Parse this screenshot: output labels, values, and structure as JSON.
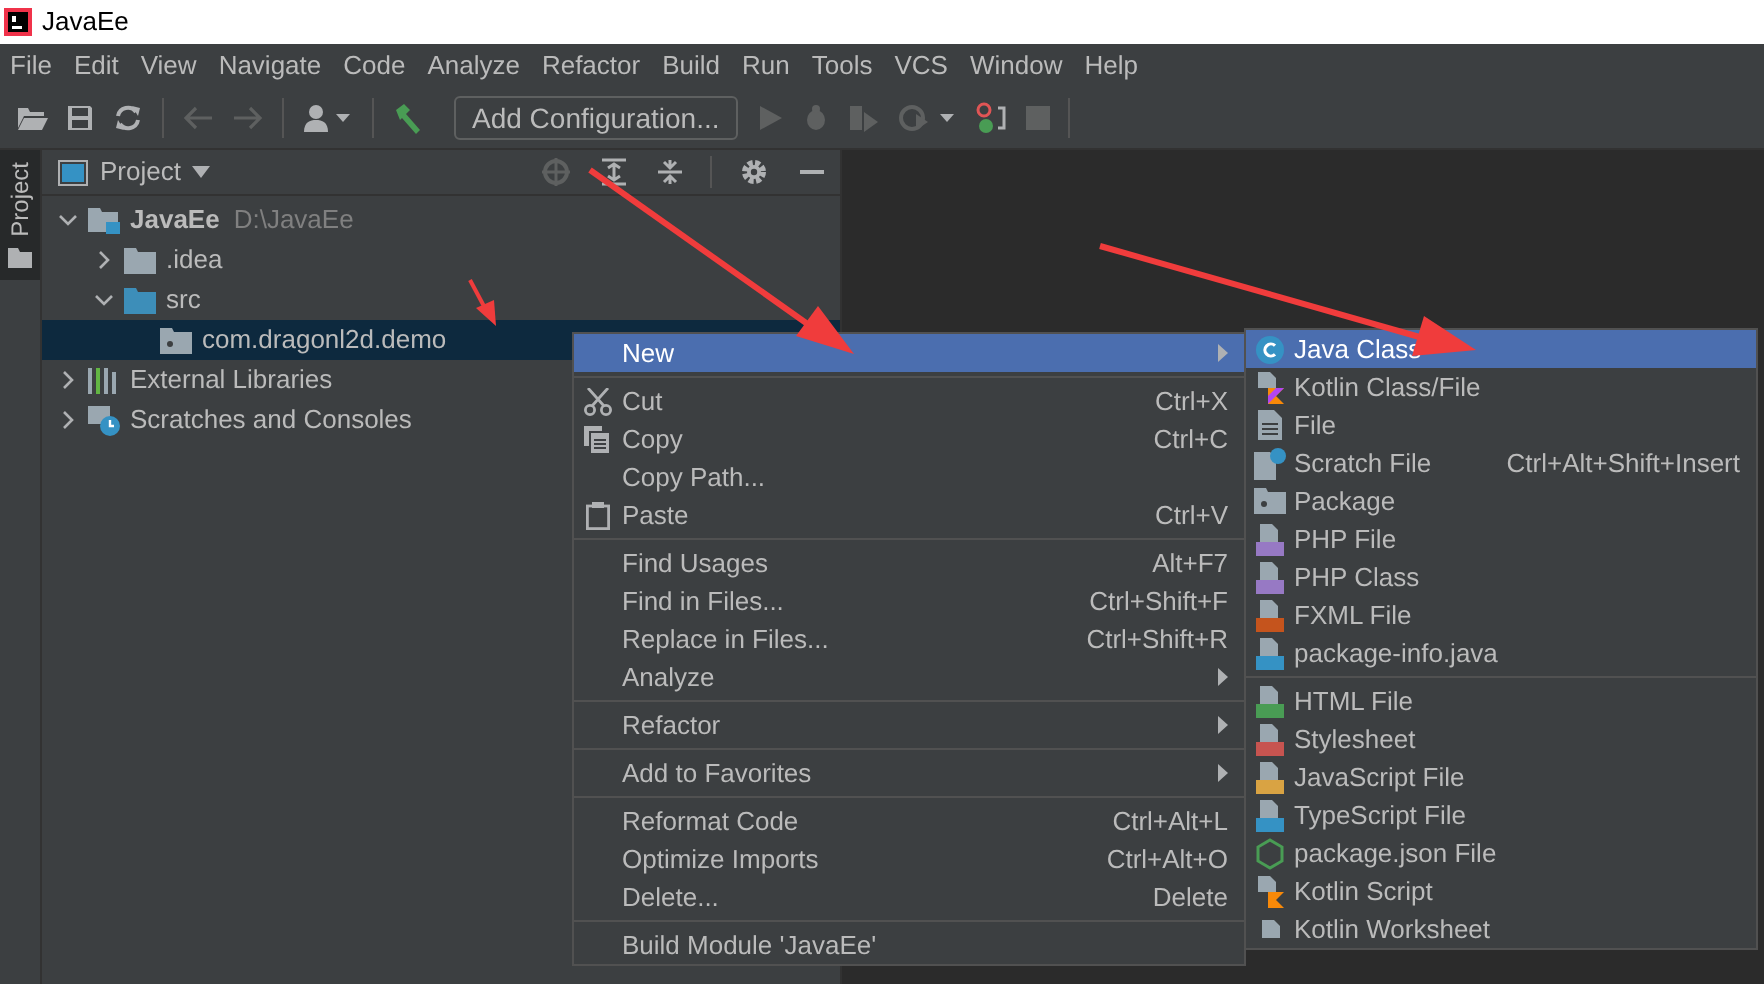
{
  "window": {
    "title": "JavaEe"
  },
  "menu_bar": [
    "File",
    "Edit",
    "View",
    "Navigate",
    "Code",
    "Analyze",
    "Refactor",
    "Build",
    "Run",
    "Tools",
    "VCS",
    "Window",
    "Help"
  ],
  "toolbar": {
    "run_configuration": "Add Configuration..."
  },
  "tool_window_stripe": [
    {
      "label": "Project",
      "selected": true
    }
  ],
  "project_panel": {
    "title": "Project",
    "tree": [
      {
        "kind": "module",
        "label": "JavaEe",
        "path": "D:\\JavaEe",
        "expanded": true,
        "selected": false,
        "children": [
          {
            "kind": "folder",
            "label": ".idea",
            "expanded": false,
            "selected": false
          },
          {
            "kind": "source-folder",
            "label": "src",
            "expanded": true,
            "selected": false,
            "children": [
              {
                "kind": "package",
                "label": "com.dragonl2d.demo",
                "selected": true
              }
            ]
          }
        ]
      },
      {
        "kind": "libraries",
        "label": "External Libraries",
        "expanded": false,
        "selected": false
      },
      {
        "kind": "scratches",
        "label": "Scratches and Consoles",
        "expanded": false,
        "selected": false
      }
    ]
  },
  "context_menu": {
    "items": [
      {
        "kind": "item",
        "label": "New",
        "has_submenu": true,
        "selected": true
      },
      {
        "kind": "separator"
      },
      {
        "kind": "item",
        "label": "Cut",
        "shortcut": "Ctrl+X",
        "has_submenu": false,
        "selected": false
      },
      {
        "kind": "item",
        "label": "Copy",
        "shortcut": "Ctrl+C",
        "has_submenu": false,
        "selected": false
      },
      {
        "kind": "item",
        "label": "Copy Path...",
        "has_submenu": false,
        "selected": false
      },
      {
        "kind": "item",
        "label": "Paste",
        "shortcut": "Ctrl+V",
        "has_submenu": false,
        "selected": false
      },
      {
        "kind": "separator"
      },
      {
        "kind": "item",
        "label": "Find Usages",
        "shortcut": "Alt+F7",
        "has_submenu": false,
        "selected": false
      },
      {
        "kind": "item",
        "label": "Find in Files...",
        "shortcut": "Ctrl+Shift+F",
        "has_submenu": false,
        "selected": false
      },
      {
        "kind": "item",
        "label": "Replace in Files...",
        "shortcut": "Ctrl+Shift+R",
        "has_submenu": false,
        "selected": false
      },
      {
        "kind": "item",
        "label": "Analyze",
        "has_submenu": true,
        "selected": false
      },
      {
        "kind": "separator"
      },
      {
        "kind": "item",
        "label": "Refactor",
        "has_submenu": true,
        "selected": false
      },
      {
        "kind": "separator"
      },
      {
        "kind": "item",
        "label": "Add to Favorites",
        "has_submenu": true,
        "selected": false
      },
      {
        "kind": "separator"
      },
      {
        "kind": "item",
        "label": "Reformat Code",
        "shortcut": "Ctrl+Alt+L",
        "has_submenu": false,
        "selected": false
      },
      {
        "kind": "item",
        "label": "Optimize Imports",
        "shortcut": "Ctrl+Alt+O",
        "has_submenu": false,
        "selected": false
      },
      {
        "kind": "item",
        "label": "Delete...",
        "shortcut": "Delete",
        "has_submenu": false,
        "selected": false
      },
      {
        "kind": "separator"
      },
      {
        "kind": "item",
        "label": "Build Module 'JavaEe'",
        "has_submenu": false,
        "selected": false
      }
    ]
  },
  "new_submenu": {
    "items": [
      {
        "kind": "item",
        "label": "Java Class",
        "selected": true
      },
      {
        "kind": "item",
        "label": "Kotlin Class/File",
        "selected": false
      },
      {
        "kind": "item",
        "label": "File",
        "selected": false
      },
      {
        "kind": "item",
        "label": "Scratch File",
        "shortcut": "Ctrl+Alt+Shift+Insert",
        "selected": false
      },
      {
        "kind": "item",
        "label": "Package",
        "selected": false
      },
      {
        "kind": "item",
        "label": "PHP File",
        "selected": false
      },
      {
        "kind": "item",
        "label": "PHP Class",
        "selected": false
      },
      {
        "kind": "item",
        "label": "FXML File",
        "selected": false
      },
      {
        "kind": "item",
        "label": "package-info.java",
        "selected": false
      },
      {
        "kind": "separator"
      },
      {
        "kind": "item",
        "label": "HTML File",
        "selected": false
      },
      {
        "kind": "item",
        "label": "Stylesheet",
        "selected": false
      },
      {
        "kind": "item",
        "label": "JavaScript File",
        "selected": false
      },
      {
        "kind": "item",
        "label": "TypeScript File",
        "selected": false
      },
      {
        "kind": "item",
        "label": "package.json File",
        "selected": false
      },
      {
        "kind": "item",
        "label": "Kotlin Script",
        "selected": false
      },
      {
        "kind": "item",
        "label": "Kotlin Worksheet",
        "selected": false
      }
    ]
  }
}
